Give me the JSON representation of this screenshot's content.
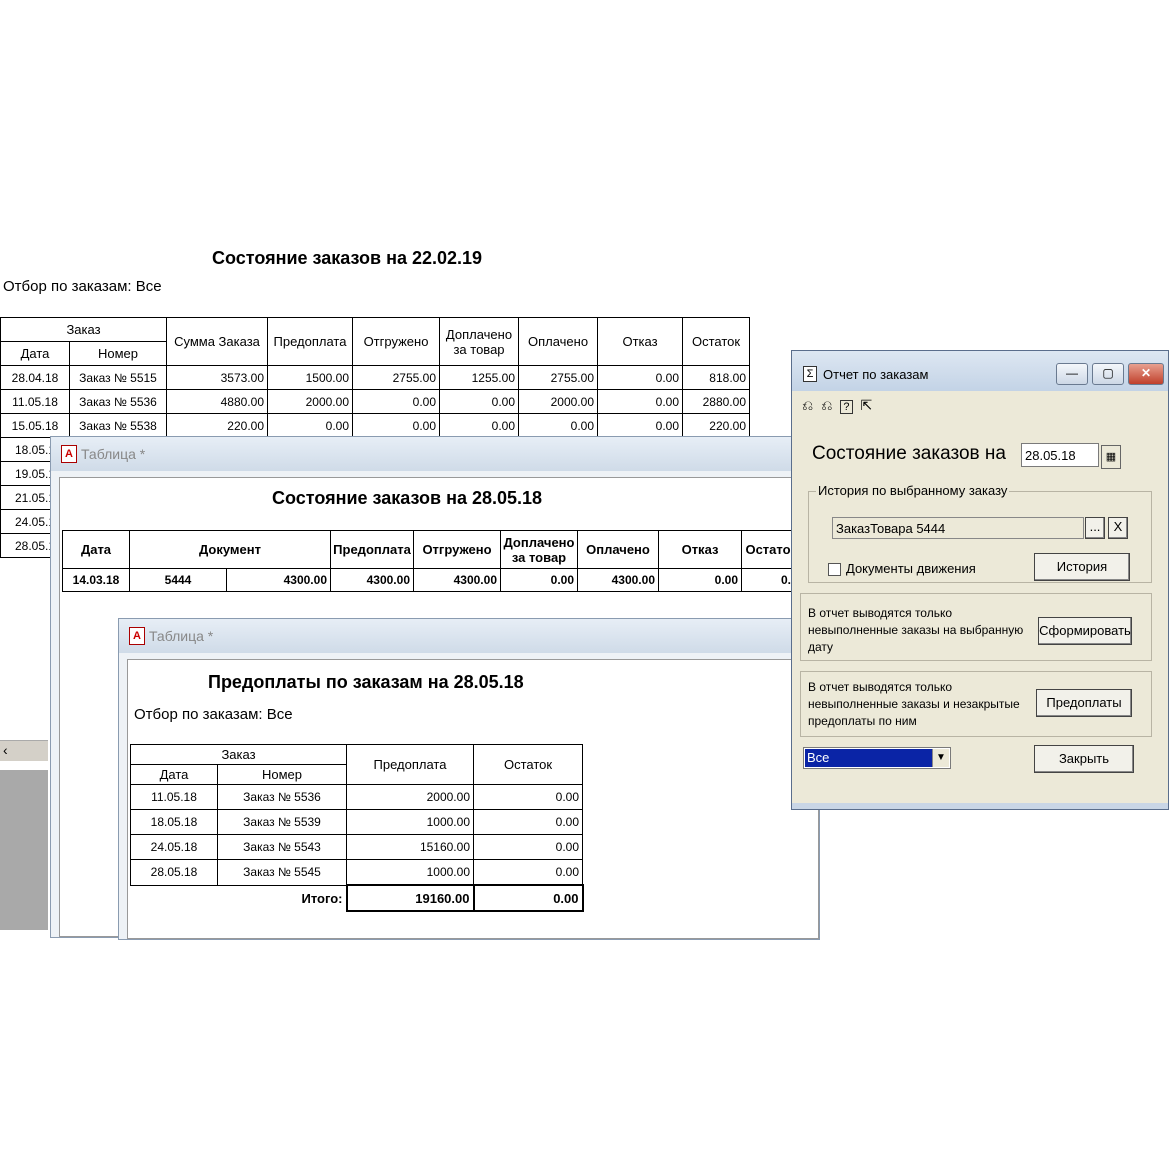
{
  "bg_report": {
    "title": "Состояние заказов на 22.02.19",
    "filter": "Отбор по заказам: Все",
    "headers": {
      "order": "Заказ",
      "date": "Дата",
      "number": "Номер",
      "sum": "Сумма Заказа",
      "prepay": "Предоплата",
      "shipped": "Отгружено",
      "extra_paid_1": "Доплачено",
      "extra_paid_2": "за товар",
      "paid": "Оплачено",
      "refused": "Отказ",
      "rest": "Остаток"
    },
    "rows": [
      {
        "date": "28.04.18",
        "number": "Заказ №  5515",
        "sum": "3573.00",
        "prepay": "1500.00",
        "shipped": "2755.00",
        "extra": "1255.00",
        "paid": "2755.00",
        "refused": "0.00",
        "rest": "818.00"
      },
      {
        "date": "11.05.18",
        "number": "Заказ №  5536",
        "sum": "4880.00",
        "prepay": "2000.00",
        "shipped": "0.00",
        "extra": "0.00",
        "paid": "2000.00",
        "refused": "0.00",
        "rest": "2880.00"
      },
      {
        "date": "15.05.18",
        "number": "Заказ №  5538",
        "sum": "220.00",
        "prepay": "0.00",
        "shipped": "0.00",
        "extra": "0.00",
        "paid": "0.00",
        "refused": "0.00",
        "rest": "220.00"
      }
    ],
    "partial_dates": [
      "18.05.1",
      "19.05.1",
      "21.05.1",
      "24.05.1",
      "28.05.1"
    ],
    "scroll_arrow": "‹"
  },
  "win1": {
    "title": "Таблица *",
    "report_title": "Состояние заказов на 28.05.18",
    "headers": {
      "date": "Дата",
      "document": "Документ",
      "prepay": "Предоплата",
      "shipped": "Отгружено",
      "extra_paid_1": "Доплачено",
      "extra_paid_2": "за товар",
      "paid": "Оплачено",
      "refused": "Отказ",
      "rest": "Остато"
    },
    "row": {
      "date": "14.03.18",
      "doc_number": "5444",
      "doc_sum": "4300.00",
      "prepay": "4300.00",
      "shipped": "4300.00",
      "extra": "0.00",
      "paid": "4300.00",
      "refused": "0.00",
      "rest": "0."
    }
  },
  "win2": {
    "title": "Таблица *",
    "report_title": "Предоплаты по заказам на 28.05.18",
    "filter": "Отбор по заказам: Все",
    "headers": {
      "order": "Заказ",
      "date": "Дата",
      "number": "Номер",
      "prepay": "Предоплата",
      "rest": "Остаток"
    },
    "rows": [
      {
        "date": "11.05.18",
        "number": "Заказ №  5536",
        "prepay": "2000.00",
        "rest": "0.00"
      },
      {
        "date": "18.05.18",
        "number": "Заказ №  5539",
        "prepay": "1000.00",
        "rest": "0.00"
      },
      {
        "date": "24.05.18",
        "number": "Заказ №  5543",
        "prepay": "15160.00",
        "rest": "0.00"
      },
      {
        "date": "28.05.18",
        "number": "Заказ №  5545",
        "prepay": "1000.00",
        "rest": "0.00"
      }
    ],
    "total_label": "Итого:",
    "total_prepay": "19160.00",
    "total_rest": "0.00"
  },
  "dialog": {
    "title": "Отчет по заказам",
    "icon": "Σ",
    "minimize": "—",
    "maximize": "▢",
    "close": "✕",
    "toolbar_icons": [
      "undo-lock-icon",
      "redo-lock-icon",
      "help-icon",
      "whats-this-icon"
    ],
    "state_label": "Состояние заказов на",
    "date": "28.05.18",
    "history_group": "История по выбранному заказу",
    "order_value": "ЗаказТовара 5444",
    "browse": "...",
    "clear": "X",
    "docs_checkbox": "Документы движения",
    "history_button": "История",
    "form_text": "В отчет выводятся только невыполненные заказы на выбранную дату",
    "form_button": "Сформировать",
    "prepay_text": "В отчет выводятся только невыполненные заказы и незакрытые предоплаты по ним",
    "prepay_button": "Предоплаты",
    "filter_value": "Все",
    "close_button": "Закрыть"
  }
}
